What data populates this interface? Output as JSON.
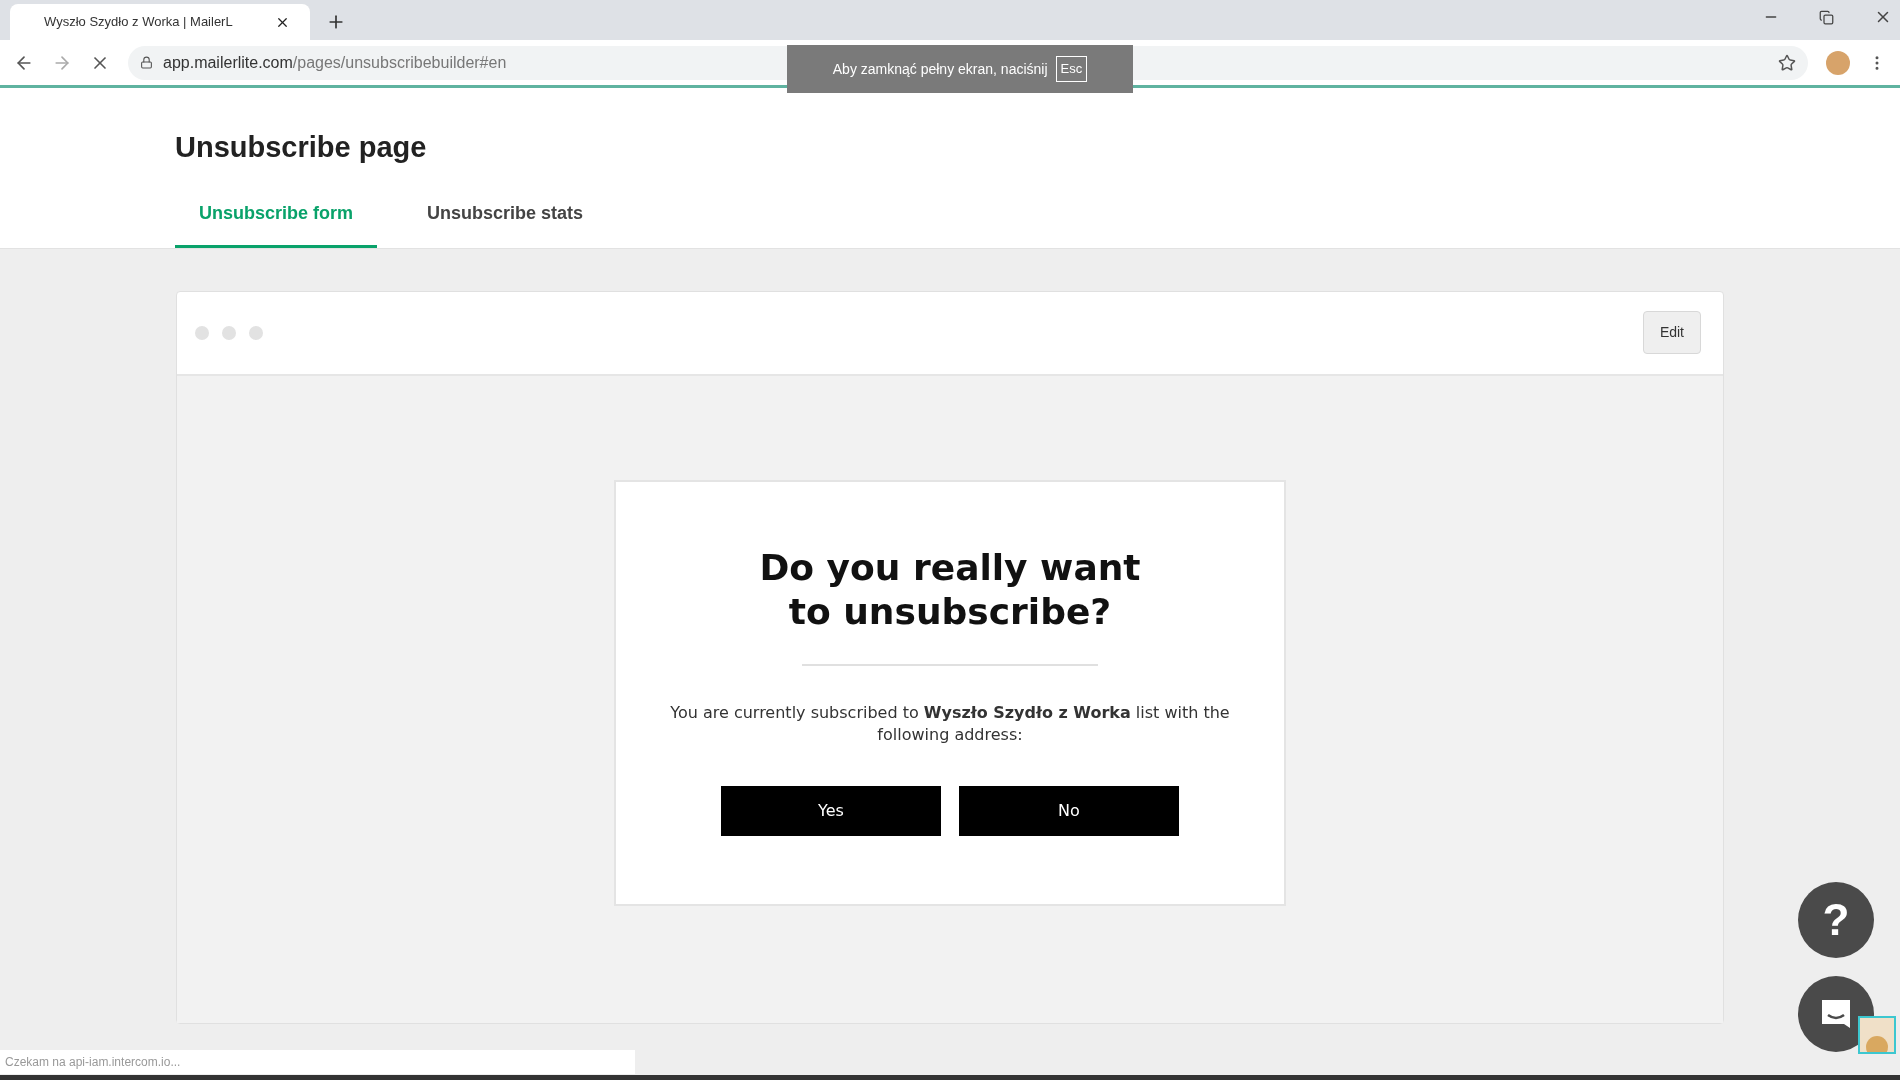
{
  "browser": {
    "tab_title": "Wyszło Szydło z Worka | MailerL",
    "url_host": "app.mailerlite.com",
    "url_path": "/pages/unsubscribebuilder#en",
    "loading": true
  },
  "fullscreen_notice": {
    "text": "Aby zamknąć pełny ekran, naciśnij",
    "key": "Esc"
  },
  "page": {
    "title": "Unsubscribe page"
  },
  "tabs": [
    {
      "label": "Unsubscribe form",
      "selected": true
    },
    {
      "label": "Unsubscribe stats",
      "selected": false
    }
  ],
  "preview": {
    "edit_button": "Edit",
    "heading": "Do you really want to unsubscribe?",
    "message": "You are currently subscribed to **Wyszło Szydło z Worka** list with the following address:",
    "buttons": [
      "Yes",
      "No"
    ]
  },
  "help": {
    "label": "?"
  },
  "status_bar": "Czekam na api-iam.intercom.io..."
}
